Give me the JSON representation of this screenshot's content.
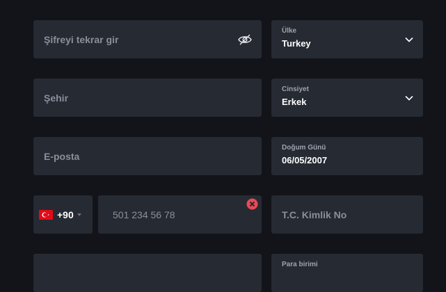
{
  "form": {
    "password_repeat": {
      "placeholder": "Şifreyi tekrar gir",
      "icon": "eye-off-icon"
    },
    "country": {
      "label": "Ülke",
      "value": "Turkey",
      "icon": "chevron-down-icon"
    },
    "city": {
      "placeholder": "Şehir"
    },
    "gender": {
      "label": "Cinsiyet",
      "value": "Erkek",
      "icon": "chevron-down-icon"
    },
    "email": {
      "placeholder": "E-posta"
    },
    "birthday": {
      "label": "Doğum Günü",
      "value": "06/05/2007"
    },
    "phone": {
      "country_code": "+90",
      "flag": "turkey-flag",
      "placeholder": "501 234 56 78",
      "clear_icon": "clear-icon"
    },
    "tc_id": {
      "placeholder": "T.C. Kimlik No"
    },
    "currency": {
      "label": "Para birimi"
    }
  },
  "colors": {
    "background": "#121419",
    "field": "#262a33",
    "error": "#e84a55",
    "flag_red": "#e30a17"
  }
}
